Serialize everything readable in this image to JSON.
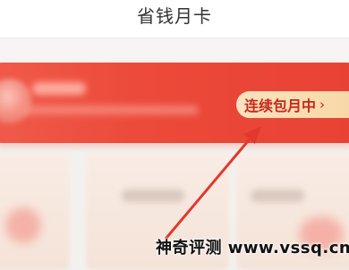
{
  "header": {
    "title": "省钱月卡"
  },
  "membership": {
    "status_label": "连续包月中",
    "status_chevron": "›"
  },
  "colors": {
    "banner": "#ec4a3a",
    "status_text": "#c5281c",
    "pill": "#f8d8a8",
    "annotation_arrow": "#e2382d"
  },
  "watermark": {
    "text": "神奇评测 www.vssq.cn"
  }
}
